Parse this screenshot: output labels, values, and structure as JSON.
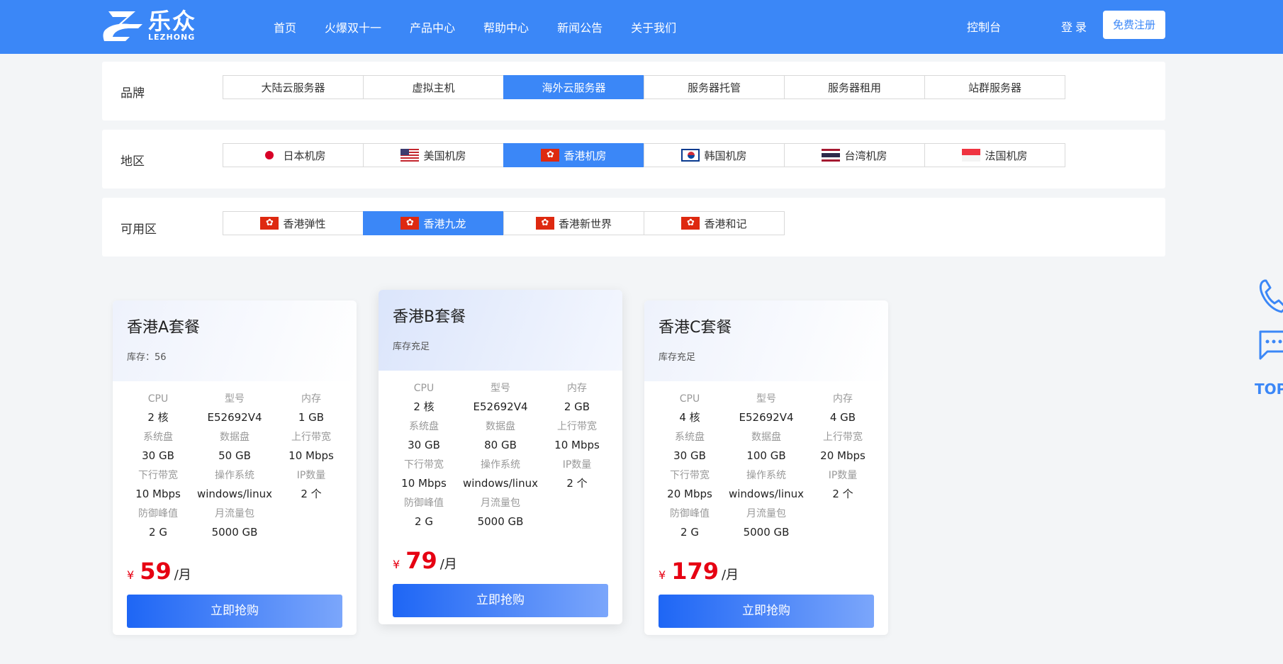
{
  "header": {
    "logo_cn": "乐众",
    "logo_en": "LEZHONG",
    "nav": [
      "首页",
      "火爆双十一",
      "产品中心",
      "帮助中心",
      "新闻公告",
      "关于我们"
    ],
    "console": "控制台",
    "login": "登录",
    "register": "免费注册"
  },
  "filters": {
    "brand": {
      "label": "品牌",
      "options": [
        "大陆云服务器",
        "虚拟主机",
        "海外云服务器",
        "服务器托管",
        "服务器租用",
        "站群服务器"
      ],
      "active": 2
    },
    "region": {
      "label": "地区",
      "options": [
        {
          "name": "日本机房",
          "flag": "jp"
        },
        {
          "name": "美国机房",
          "flag": "us"
        },
        {
          "name": "香港机房",
          "flag": "hk"
        },
        {
          "name": "韩国机房",
          "flag": "kr"
        },
        {
          "name": "台湾机房",
          "flag": "th"
        },
        {
          "name": "法国机房",
          "flag": "sg"
        }
      ],
      "active": 2
    },
    "zone": {
      "label": "可用区",
      "options": [
        {
          "name": "香港弹性",
          "flag": "hk"
        },
        {
          "name": "香港九龙",
          "flag": "hk"
        },
        {
          "name": "香港新世界",
          "flag": "hk"
        },
        {
          "name": "香港和记",
          "flag": "hk"
        }
      ],
      "active": 1
    }
  },
  "plans": [
    {
      "title": "香港A套餐",
      "stock": "库存：56",
      "specs": [
        [
          "CPU",
          "2 核"
        ],
        [
          "型号",
          "E52692V4"
        ],
        [
          "内存",
          "1 GB"
        ],
        [
          "系统盘",
          "30 GB"
        ],
        [
          "数据盘",
          "50 GB"
        ],
        [
          "上行带宽",
          "10 Mbps"
        ],
        [
          "下行带宽",
          "10 Mbps"
        ],
        [
          "操作系统",
          "windows/linux"
        ],
        [
          "IP数量",
          "2 个"
        ],
        [
          "防御峰值",
          "2 G"
        ],
        [
          "月流量包",
          "5000 GB"
        ]
      ],
      "currency": "¥",
      "price": "59",
      "unit": "/月",
      "button": "立即抢购"
    },
    {
      "title": "香港B套餐",
      "stock": "库存充足",
      "specs": [
        [
          "CPU",
          "2 核"
        ],
        [
          "型号",
          "E52692V4"
        ],
        [
          "内存",
          "2 GB"
        ],
        [
          "系统盘",
          "30 GB"
        ],
        [
          "数据盘",
          "80 GB"
        ],
        [
          "上行带宽",
          "10 Mbps"
        ],
        [
          "下行带宽",
          "10 Mbps"
        ],
        [
          "操作系统",
          "windows/linux"
        ],
        [
          "IP数量",
          "2 个"
        ],
        [
          "防御峰值",
          "2 G"
        ],
        [
          "月流量包",
          "5000 GB"
        ]
      ],
      "currency": "¥",
      "price": "79",
      "unit": "/月",
      "button": "立即抢购"
    },
    {
      "title": "香港C套餐",
      "stock": "库存充足",
      "specs": [
        [
          "CPU",
          "4 核"
        ],
        [
          "型号",
          "E52692V4"
        ],
        [
          "内存",
          "4 GB"
        ],
        [
          "系统盘",
          "30 GB"
        ],
        [
          "数据盘",
          "100 GB"
        ],
        [
          "上行带宽",
          "20 Mbps"
        ],
        [
          "下行带宽",
          "20 Mbps"
        ],
        [
          "操作系统",
          "windows/linux"
        ],
        [
          "IP数量",
          "2 个"
        ],
        [
          "防御峰值",
          "2 G"
        ],
        [
          "月流量包",
          "5000 GB"
        ]
      ],
      "currency": "¥",
      "price": "179",
      "unit": "/月",
      "button": "立即抢购"
    }
  ],
  "float": {
    "icons": [
      "phone-icon",
      "chat-icon"
    ],
    "top": "TOP"
  },
  "colors": {
    "primary": "#3b87f7",
    "price": "#e60012"
  }
}
